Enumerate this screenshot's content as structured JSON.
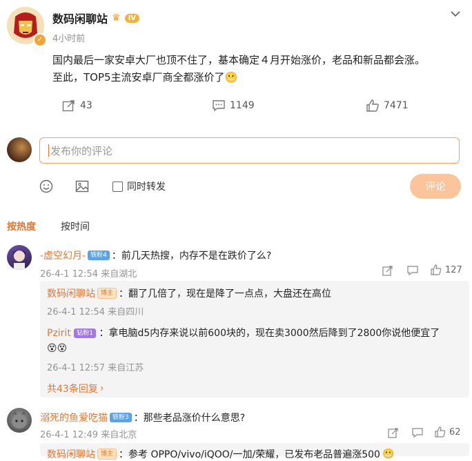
{
  "post": {
    "author": "数码闲聊站",
    "level_badge": "IV",
    "time": "4小时前",
    "text_line1": "国内最后一家安卓大厂也顶不住了，基本确定４月开始涨价，老品和新品都会涨。",
    "text_line2": "至此，TOP5主流安卓厂商全都涨价了",
    "emoji": "😬",
    "reposts": "43",
    "comments": "1149",
    "likes": "7471"
  },
  "composer": {
    "placeholder": "发布你的评论",
    "repost_label": "同时转发",
    "submit_label": "评论"
  },
  "sort_tabs": {
    "hot": "按热度",
    "time": "按时间"
  },
  "comments": [
    {
      "user": "-虚空幻月-",
      "fan_badge": "铁粉4",
      "text": "：前几天热搜，内存不是在跌价了么?",
      "meta": "26-4-1 12:54 来自湖北",
      "likes": "127",
      "replies": [
        {
          "user": "数码闲聊站",
          "badge": "博主",
          "text": "：翻了几倍了，现在是降了一点点，大盘还在高位",
          "meta": "26-4-1 12:54 来自四川"
        },
        {
          "user": "Pzirit",
          "badge": "钻粉1",
          "text": "：拿电脑d5内存来说以前600块的，现在卖3000然后降到了2800你说他便宜了",
          "emoji": "😵😵",
          "meta": "26-4-1 12:57 来自江苏"
        }
      ],
      "more_replies": "共43条回复"
    },
    {
      "user": "溺死的鱼爱吃猫",
      "fan_badge": "铁粉3",
      "text": "：那些老品涨价什么意思?",
      "meta": "26-4-1 12:49 来自北京",
      "likes": "62",
      "replies": [
        {
          "user": "数码闲聊站",
          "badge": "博主",
          "text": "：参考 OPPO/vivo/iQOO/一加/荣耀，已发布老品普遍涨500",
          "emoji": "😬"
        }
      ]
    }
  ],
  "colors": {
    "accent": "#e6742b",
    "submit_bg": "#fbc49a",
    "link_orange": "#e07a36"
  }
}
